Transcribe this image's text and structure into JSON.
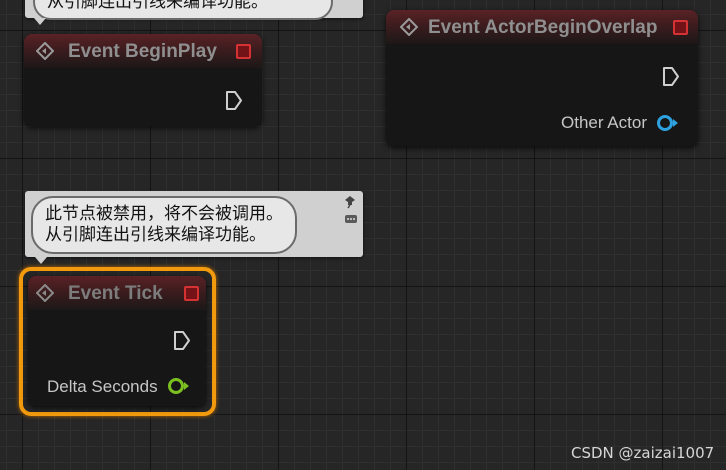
{
  "top_comment": {
    "visible_text": "从引脚连出引线来编译功能。"
  },
  "tick_comment": {
    "line1": "此节点被禁用，将不会被调用。",
    "line2": "从引脚连出引线来编译功能。"
  },
  "begin_play": {
    "title": "Event BeginPlay"
  },
  "actor_overlap": {
    "title": "Event ActorBeginOverlap",
    "pin_label": "Other Actor",
    "pin_color": "#2ea2e0"
  },
  "tick": {
    "title": "Event Tick",
    "pin_label": "Delta Seconds",
    "pin_color": "#7cbf20",
    "selected_color": "#f19a0d"
  },
  "watermark": "CSDN @zaizai1007"
}
